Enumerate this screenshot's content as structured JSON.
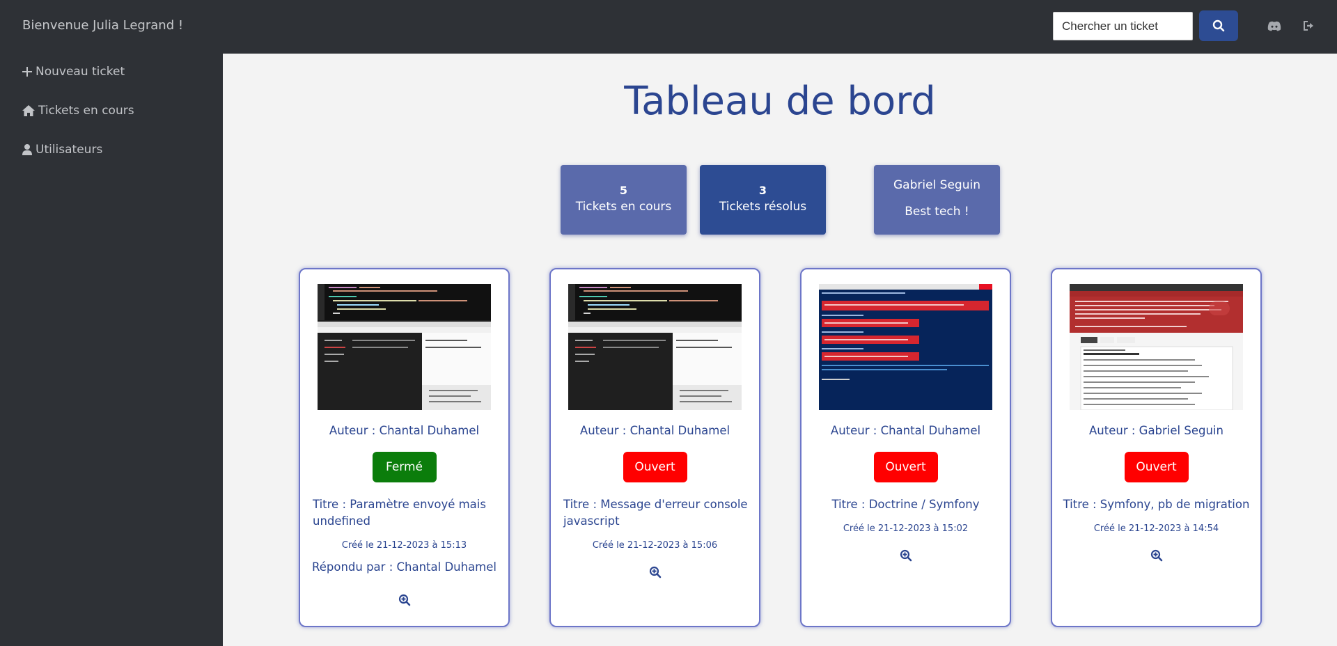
{
  "header": {
    "welcome": "Bienvenue Julia Legrand !",
    "search_placeholder": "Chercher un ticket",
    "search_icon": "search-icon",
    "discord_icon": "discord-icon",
    "logout_icon": "logout-icon"
  },
  "sidebar": {
    "items": [
      {
        "label": "Nouveau ticket",
        "icon": "plus-icon"
      },
      {
        "label": "Tickets en cours",
        "icon": "home-icon"
      },
      {
        "label": "Utilisateurs",
        "icon": "user-icon"
      }
    ]
  },
  "main": {
    "title": "Tableau de bord",
    "stats": [
      {
        "count": "5",
        "label": "Tickets en cours",
        "color": "#5a6aab"
      },
      {
        "count": "3",
        "label": "Tickets résolus",
        "color": "#2d4c93"
      }
    ],
    "best_tech": {
      "name": "Gabriel Seguin",
      "label": "Best tech !",
      "color": "#5a6aab"
    }
  },
  "tickets": [
    {
      "author": "Auteur : Chantal Duhamel",
      "status": "Fermé",
      "status_color": "#0b7d0b",
      "title": "Titre : Paramètre envoyé mais undefined",
      "created": "Créé le 21-12-2023 à 15:13",
      "answered": "Répondu par : Chantal Duhamel"
    },
    {
      "author": "Auteur : Chantal Duhamel",
      "status": "Ouvert",
      "status_color": "#ff0000",
      "title": "Titre : Message d'erreur console javascript",
      "created": "Créé le 21-12-2023 à 15:06",
      "answered": ""
    },
    {
      "author": "Auteur : Chantal Duhamel",
      "status": "Ouvert",
      "status_color": "#ff0000",
      "title": "Titre : Doctrine / Symfony",
      "created": "Créé le 21-12-2023 à 15:02",
      "answered": ""
    },
    {
      "author": "Auteur : Gabriel Seguin",
      "status": "Ouvert",
      "status_color": "#ff0000",
      "title": "Titre : Symfony, pb de migration",
      "created": "Créé le 21-12-2023 à 14:54",
      "answered": ""
    }
  ],
  "colors": {
    "accent": "#2b4590",
    "sidebar_bg": "#2e3136",
    "page_bg": "#f3f3f3",
    "card_border": "#6d76c8"
  }
}
